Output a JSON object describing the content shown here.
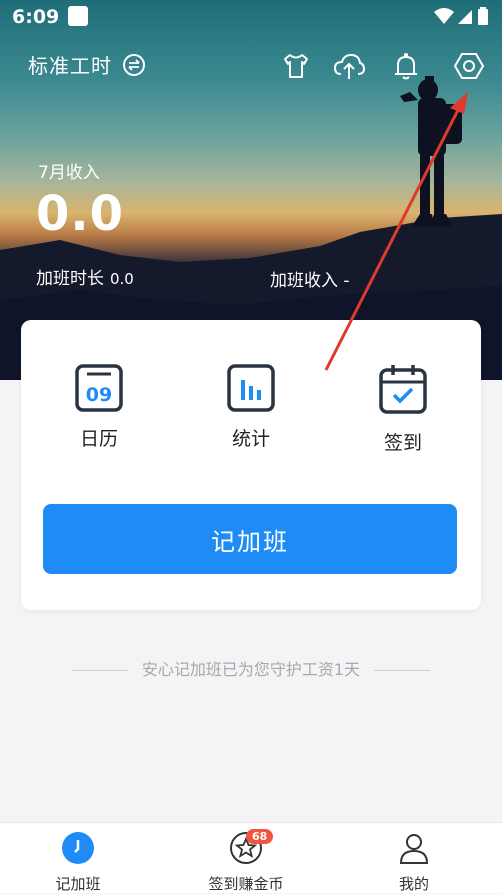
{
  "status_bar": {
    "time": "6:09"
  },
  "header": {
    "title": "标准工时",
    "icons": [
      "shirt-icon",
      "cloud-upload-icon",
      "bell-icon",
      "settings-hexagon-icon"
    ]
  },
  "summary": {
    "month_label": "7月收入",
    "income": "0.0",
    "overtime_duration_label": "加班时长",
    "overtime_duration_value": "0.0",
    "overtime_income_label": "加班收入",
    "overtime_income_value": "-"
  },
  "actions": [
    {
      "label": "日历",
      "icon": "calendar-icon",
      "icon_text": "09"
    },
    {
      "label": "统计",
      "icon": "stats-icon"
    },
    {
      "label": "签到",
      "icon": "checkin-icon"
    }
  ],
  "primary_button": {
    "label": "记加班",
    "color": "#1f8bf5"
  },
  "slogan": "安心记加班已为您守护工资1天",
  "tabs": [
    {
      "label": "记加班",
      "icon": "clock-icon",
      "active": true
    },
    {
      "label": "签到赚金币",
      "icon": "star-icon",
      "badge": "68"
    },
    {
      "label": "我的",
      "icon": "user-icon"
    }
  ]
}
